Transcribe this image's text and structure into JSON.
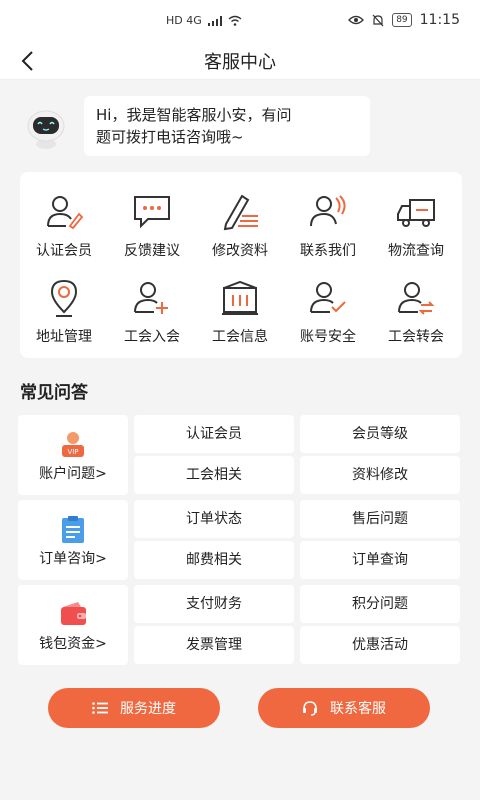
{
  "status": {
    "left": "HD 4G",
    "battery": "89",
    "time": "11:15"
  },
  "header": {
    "title": "客服中心"
  },
  "bot": {
    "line1": "Hi，我是智能客服小安，有问",
    "line2": "题可拨打电话咨询哦~"
  },
  "services": [
    {
      "label": "认证会员",
      "icon": "user-edit-icon"
    },
    {
      "label": "反馈建议",
      "icon": "chat-bubble-icon"
    },
    {
      "label": "修改资料",
      "icon": "pencil-doc-icon"
    },
    {
      "label": "联系我们",
      "icon": "user-call-icon"
    },
    {
      "label": "物流查询",
      "icon": "truck-icon"
    },
    {
      "label": "地址管理",
      "icon": "location-pin-icon"
    },
    {
      "label": "工会入会",
      "icon": "user-add-icon"
    },
    {
      "label": "工会信息",
      "icon": "building-icon"
    },
    {
      "label": "账号安全",
      "icon": "user-check-icon"
    },
    {
      "label": "工会转会",
      "icon": "user-transfer-icon"
    }
  ],
  "faq": {
    "title": "常见问答",
    "categories": [
      {
        "label": "账户问题>",
        "icon": "vip-user-icon",
        "questions": [
          "认证会员",
          "会员等级",
          "工会相关",
          "资料修改"
        ]
      },
      {
        "label": "订单咨询>",
        "icon": "clipboard-icon",
        "questions": [
          "订单状态",
          "售后问题",
          "邮费相关",
          "订单查询"
        ]
      },
      {
        "label": "钱包资金>",
        "icon": "wallet-icon",
        "questions": [
          "支付财务",
          "积分问题",
          "发票管理",
          "优惠活动"
        ]
      }
    ]
  },
  "actions": {
    "progress_label": "服务进度",
    "contact_label": "联系客服"
  },
  "colors": {
    "accent": "#f0683f",
    "icon_stroke": "#333333"
  }
}
